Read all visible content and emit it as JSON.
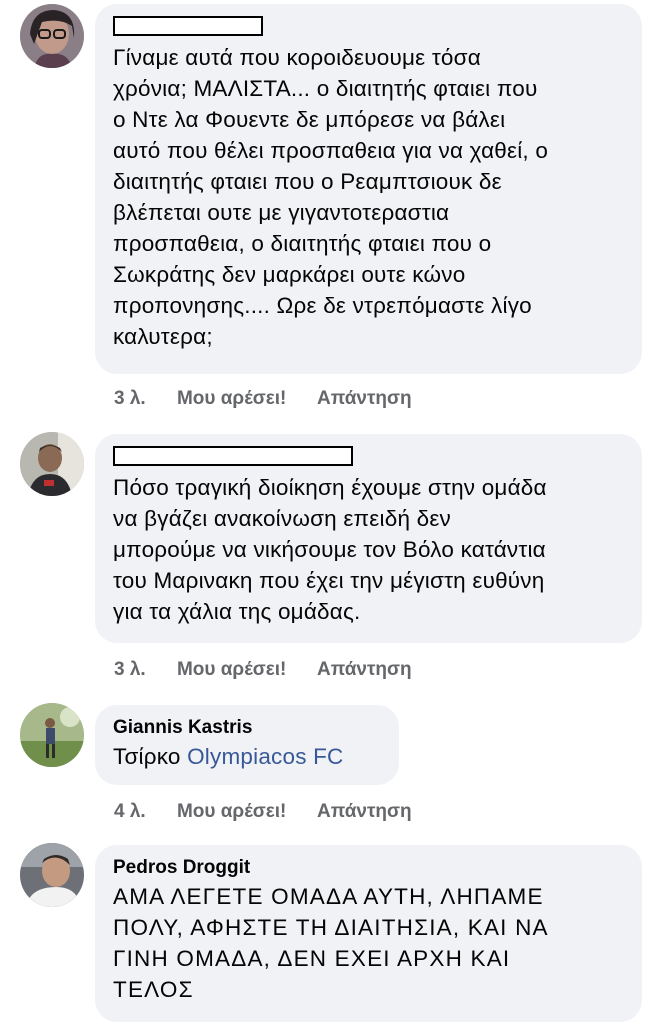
{
  "comments": [
    {
      "author": "",
      "author_redacted": true,
      "lines": [
        "Γίναμε αυτά που κοροιδευουμε τόσα",
        "χρόνια; ΜΑΛΙΣΤΑ... ο διαιτητής φταιει που",
        "ο Ντε λα Φουεντε δε μπόρεσε να βάλει",
        "αυτό που θέλει προσπαθεια για να χαθεί, ο",
        "διαιτητής φταιει που ο Ρεαμπτσιουκ δε",
        "βλέπεται ουτε με γιγαντοτεραστια",
        "προσπαθεια, ο διαιτητής φταιει που ο",
        "Σωκράτης δεν μαρκάρει ουτε κώνο",
        "προπονησης.... Ωρε δε ντρεπόμαστε λίγο",
        "καλυτερα;"
      ],
      "time": "3 λ.",
      "like_label": "Μου αρέσει!",
      "reply_label": "Απάντηση"
    },
    {
      "author": "",
      "author_redacted": true,
      "lines": [
        "Πόσο τραγική διοίκηση έχουμε στην ομάδα",
        "να βγάζει ανακοίνωση επειδή δεν",
        "μπορούμε να νικήσουμε τον Βόλο κατάντια",
        "του Μαρινακη που έχει την μέγιστη ευθύνη",
        "για τα χάλια της ομάδας."
      ],
      "time": "3 λ.",
      "like_label": "Μου αρέσει!",
      "reply_label": "Απάντηση"
    },
    {
      "author": "Giannis Kastris",
      "author_redacted": false,
      "text_prefix": "Τσίρκο",
      "mention": "Olympiacos FC",
      "time": "4 λ.",
      "like_label": "Μου αρέσει!",
      "reply_label": "Απάντηση"
    },
    {
      "author": "Pedros Droggit",
      "author_redacted": false,
      "lines": [
        "ΑΜΑ ΛΕΓΕΤΕ ΟΜΑΔΑ ΑΥΤΗ, ΛΗΠΑΜΕ",
        "ΠΟΛΥ, ΑΦΗΣΤΕ ΤΗ ΔΙΑΙΤΗΣΙΑ, ΚΑΙ ΝΑ",
        "ΓΙΝΗ ΟΜΑΔΑ, ΔΕΝ ΕΧΕΙ ΑΡΧΗ ΚΑΙ",
        "ΤΕΛΟΣ"
      ]
    }
  ],
  "colors": {
    "bubble": "#f0f2f5",
    "mention": "#385898",
    "meta": "#65676b"
  }
}
